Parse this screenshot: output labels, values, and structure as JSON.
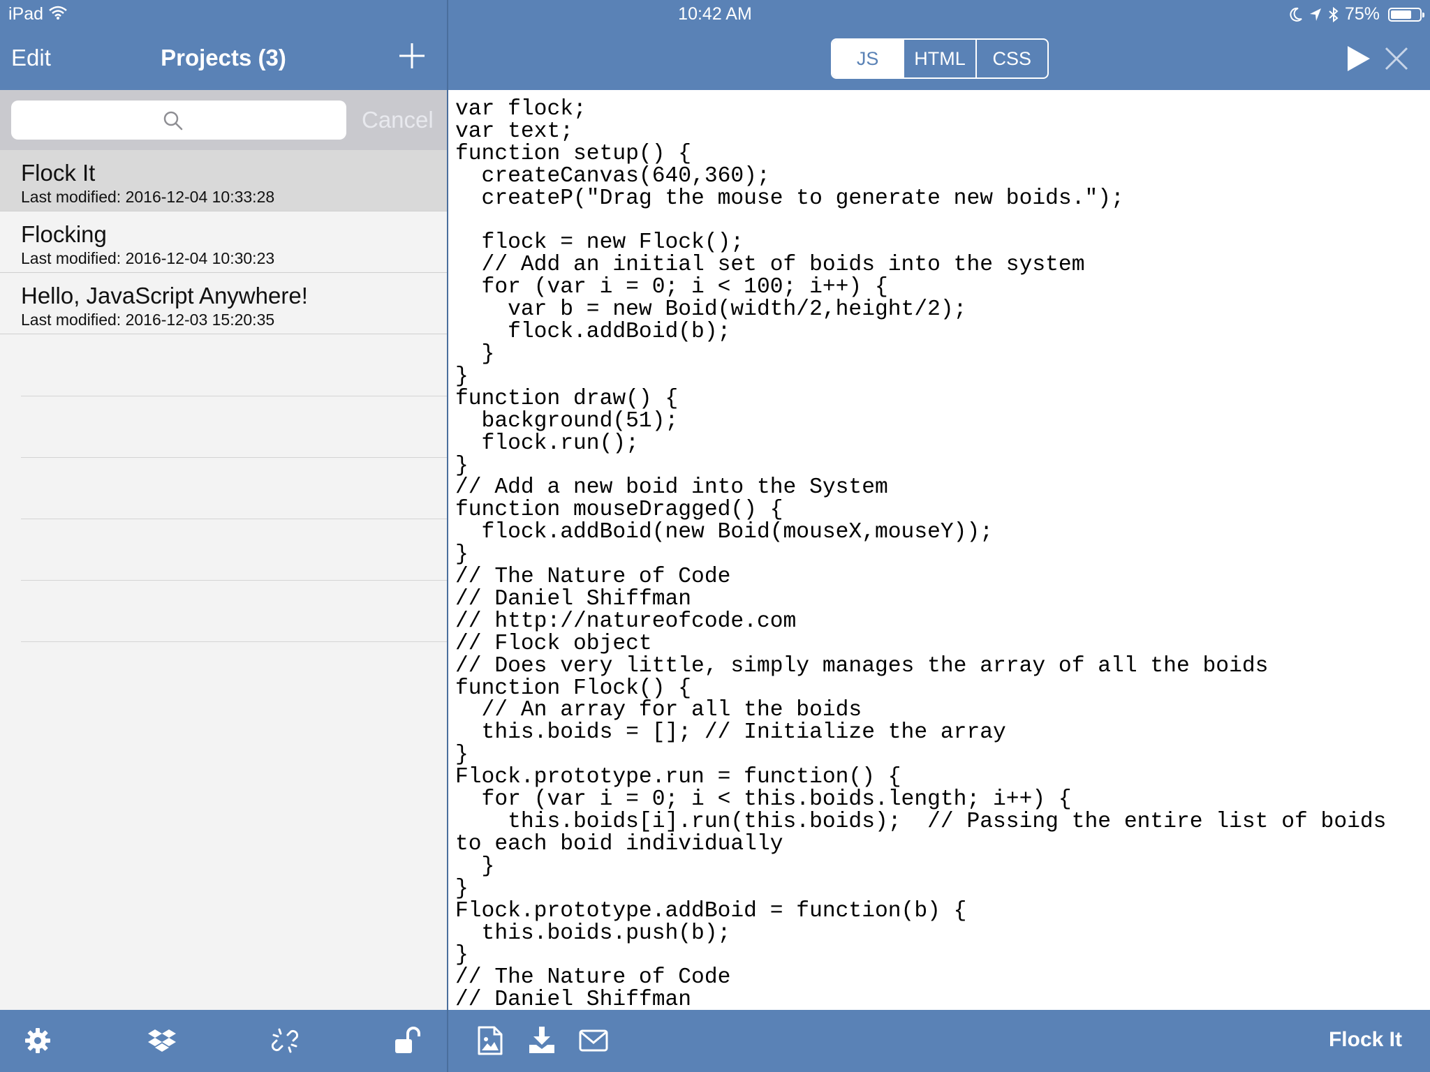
{
  "status_bar": {
    "device": "iPad",
    "time": "10:42 AM",
    "battery": "75%",
    "battery_level": 0.75
  },
  "sidebar": {
    "edit_label": "Edit",
    "title": "Projects (3)",
    "search": {
      "placeholder": "",
      "cancel_label": "Cancel"
    },
    "projects": [
      {
        "name": "Flock It",
        "modified": "Last modified: 2016-12-04 10:33:28",
        "selected": true
      },
      {
        "name": "Flocking",
        "modified": "Last modified: 2016-12-04 10:30:23",
        "selected": false
      },
      {
        "name": "Hello, JavaScript Anywhere!",
        "modified": "Last modified: 2016-12-03 15:20:35",
        "selected": false
      }
    ],
    "toolbar_icons": [
      "gear-icon",
      "dropbox-icon",
      "broken-link-icon",
      "unlock-icon"
    ]
  },
  "editor": {
    "tabs": [
      {
        "label": "JS",
        "active": true
      },
      {
        "label": "HTML",
        "active": false
      },
      {
        "label": "CSS",
        "active": false
      }
    ],
    "code": "var flock;\nvar text;\nfunction setup() {\n  createCanvas(640,360);\n  createP(\"Drag the mouse to generate new boids.\");\n\n  flock = new Flock();\n  // Add an initial set of boids into the system\n  for (var i = 0; i < 100; i++) {\n    var b = new Boid(width/2,height/2);\n    flock.addBoid(b);\n  }\n}\nfunction draw() {\n  background(51);\n  flock.run();\n}\n// Add a new boid into the System\nfunction mouseDragged() {\n  flock.addBoid(new Boid(mouseX,mouseY));\n}\n// The Nature of Code\n// Daniel Shiffman\n// http://natureofcode.com\n// Flock object\n// Does very little, simply manages the array of all the boids\nfunction Flock() {\n  // An array for all the boids\n  this.boids = []; // Initialize the array\n}\nFlock.prototype.run = function() {\n  for (var i = 0; i < this.boids.length; i++) {\n    this.boids[i].run(this.boids);  // Passing the entire list of boids\nto each boid individually\n  }\n}\nFlock.prototype.addBoid = function(b) {\n  this.boids.push(b);\n}\n// The Nature of Code\n// Daniel Shiffman",
    "toolbar_icons": [
      "image-icon",
      "download-icon",
      "mail-icon"
    ],
    "footer_project_name": "Flock It"
  },
  "colors": {
    "bar": "#5a82b6",
    "selected_row": "#d9d9d9",
    "list_background": "#f3f3f3"
  }
}
